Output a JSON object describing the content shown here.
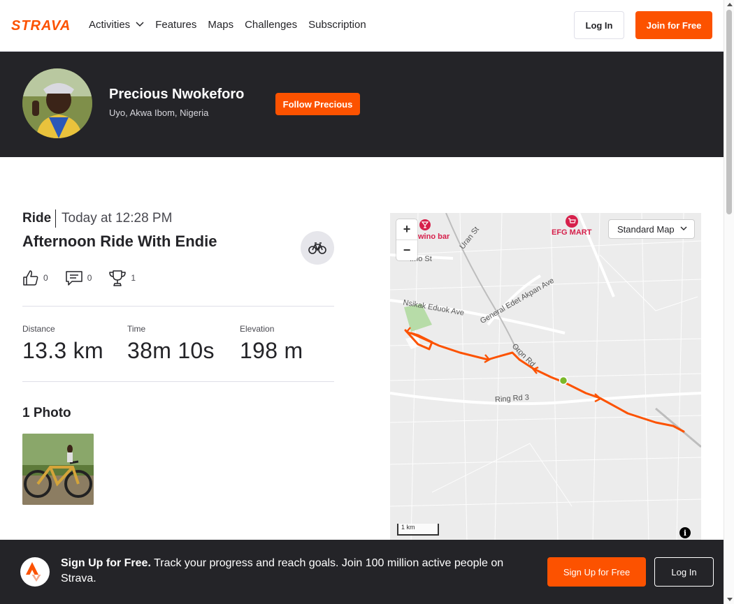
{
  "nav": {
    "logo_text": "STRAVA",
    "links": [
      "Activities",
      "Features",
      "Maps",
      "Challenges",
      "Subscription"
    ],
    "login": "Log In",
    "join": "Join for Free"
  },
  "athlete": {
    "name": "Precious Nwokeforo",
    "location": "Uyo, Akwa Ibom, Nigeria",
    "follow": "Follow Precious"
  },
  "activity": {
    "type": "Ride",
    "time": "Today at 12:28 PM",
    "title": "Afternoon Ride With Endie",
    "kudos": "0",
    "comments": "0",
    "achievements": "1",
    "stats": {
      "distance_label": "Distance",
      "distance": "13.3 km",
      "time_label": "Time",
      "time": "38m 10s",
      "elevation_label": "Elevation",
      "elevation": "198 m"
    },
    "photos_title": "1 Photo"
  },
  "map": {
    "style_select": "Standard Map",
    "zoom_in": "+",
    "zoom_out": "−",
    "scale": "1 km",
    "info": "i",
    "labels": {
      "bar": "wino bar",
      "efg": "EFG MART",
      "uran": "Uran St",
      "imo": "Imo St",
      "nsikak": "Nsikak Eduok Ave",
      "edet": "General Edet Akpan Ave",
      "oron": "Oron Rd",
      "ring": "Ring Rd 3"
    }
  },
  "banner": {
    "headline": "Sign Up for Free.",
    "body": "Track your progress and reach goals. Join 100 million active people on Strava.",
    "signup": "Sign Up for Free",
    "login": "Log In"
  },
  "colors": {
    "brand": "#fc5200",
    "dark": "#242428",
    "route": "#fc5200"
  }
}
